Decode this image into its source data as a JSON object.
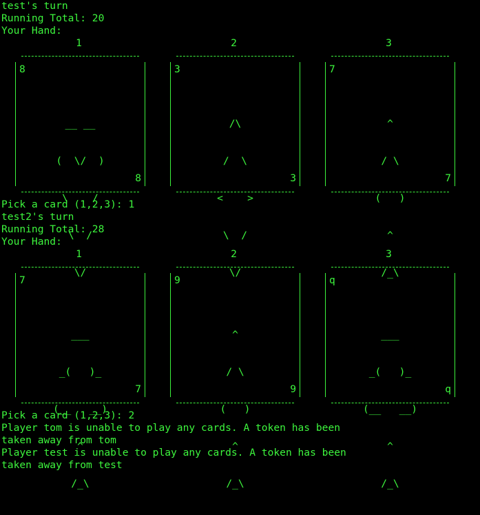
{
  "colors": {
    "background": "#000000",
    "text": "#3df53d"
  },
  "turn1": {
    "turn_text": "test's turn",
    "running_total": "Running Total: 20",
    "hand_label": "Your Hand:",
    "cards": [
      {
        "number": "1",
        "rank": "8",
        "suit": "heart-icon",
        "art": [
          " __ __ ",
          "(  \\/  )",
          " \\    / ",
          "  \\  /  ",
          "   \\/   "
        ]
      },
      {
        "number": "2",
        "rank": "3",
        "suit": "diamond-icon",
        "art": [
          "  /\\  ",
          " /  \\ ",
          "<    >",
          " \\  / ",
          "  \\/  "
        ]
      },
      {
        "number": "3",
        "rank": "7",
        "suit": "spade-icon",
        "art": [
          "  ^  ",
          " / \\ ",
          "(   )",
          "  ^  ",
          " /_\\ "
        ]
      }
    ],
    "prompt": "Pick a card (1,2,3): 1"
  },
  "turn2": {
    "turn_text": "test2's turn",
    "running_total": "Running Total: 28",
    "hand_label": "Your Hand:",
    "cards": [
      {
        "number": "1",
        "rank": "7",
        "suit": "club-icon",
        "art": [
          "   ___   ",
          " _(   )_ ",
          "(__   __)",
          "    ^    ",
          "   /_\\   "
        ]
      },
      {
        "number": "2",
        "rank": "9",
        "suit": "spade-icon",
        "art": [
          "  ^  ",
          " / \\ ",
          "(   )",
          "  ^  ",
          " /_\\ "
        ]
      },
      {
        "number": "3",
        "rank": "q",
        "suit": "club-icon",
        "art": [
          "   ___   ",
          " _(   )_ ",
          "(__   __)",
          "    ^    ",
          "   /_\\   "
        ]
      }
    ],
    "prompt": "Pick a card (1,2,3): 2"
  },
  "messages": [
    "Player tom is unable to play any cards. A token has been",
    "taken away from tom",
    "Player test is unable to play any cards. A token has been",
    "taken away from test"
  ]
}
